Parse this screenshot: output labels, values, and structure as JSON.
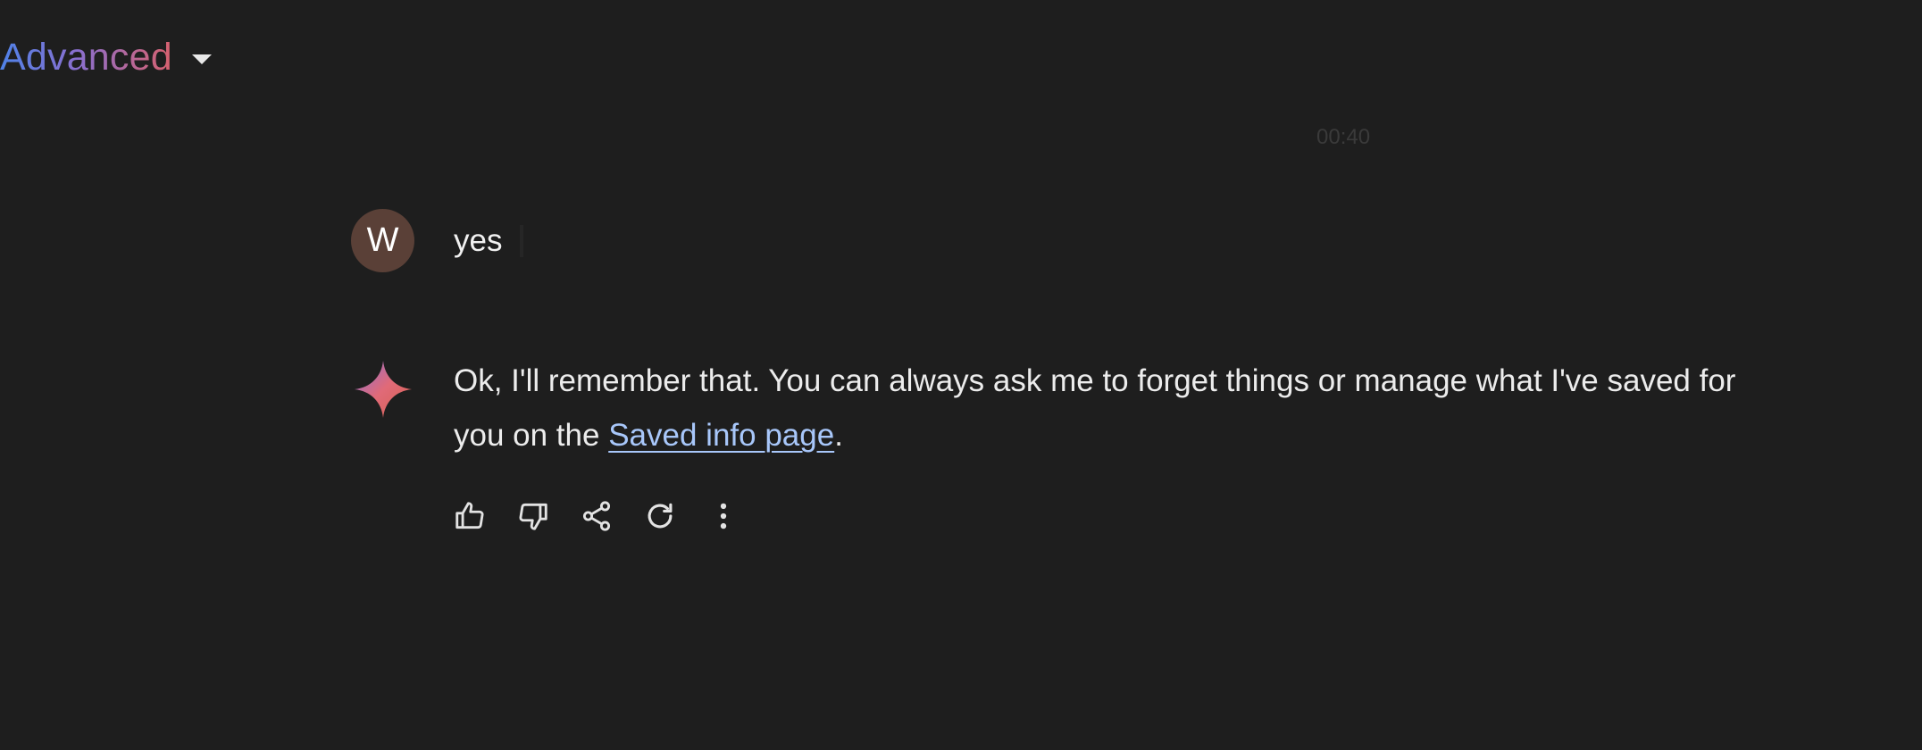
{
  "header": {
    "model_label": "Advanced",
    "model_caret_icon": "caret-down-icon",
    "gradient_colors": [
      "#4f82e8",
      "#8a6fce",
      "#d8616e"
    ]
  },
  "timestamp": "00:40",
  "conversation": {
    "user_message": {
      "avatar_initial": "W",
      "avatar_color": "#5a4037",
      "text": "yes"
    },
    "assistant_message": {
      "icon": "gemini-spark-icon",
      "text_before_link": "Ok, I'll remember that. You can always ask me to forget things or manage what I've saved for you on the ",
      "link_text": "Saved info page",
      "text_after_link": ".",
      "link_color": "#a8c7fa"
    },
    "actions": [
      {
        "name": "thumbs-up-icon"
      },
      {
        "name": "thumbs-down-icon"
      },
      {
        "name": "share-icon"
      },
      {
        "name": "regenerate-icon"
      },
      {
        "name": "more-vert-icon"
      }
    ]
  },
  "colors": {
    "background": "#1e1e1e",
    "text": "#ececec"
  }
}
